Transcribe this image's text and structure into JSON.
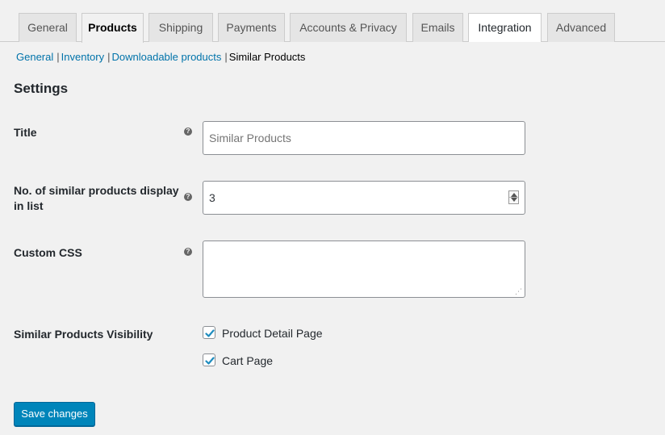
{
  "tabs": [
    {
      "label": "General"
    },
    {
      "label": "Products"
    },
    {
      "label": "Shipping"
    },
    {
      "label": "Payments"
    },
    {
      "label": "Accounts & Privacy"
    },
    {
      "label": "Emails"
    },
    {
      "label": "Integration"
    },
    {
      "label": "Advanced"
    }
  ],
  "subnav": {
    "items": [
      "General",
      "Inventory",
      "Downloadable products"
    ],
    "current": "Similar Products",
    "separator": "|"
  },
  "section_title": "Settings",
  "fields": {
    "title": {
      "label": "Title",
      "placeholder": "Similar Products",
      "value": ""
    },
    "count": {
      "label_line1": "No. of similar products display",
      "label_line2": "in list",
      "value": "3"
    },
    "css": {
      "label": "Custom CSS",
      "value": ""
    },
    "visibility": {
      "label": "Similar Products Visibility",
      "options": [
        {
          "label": "Product Detail Page",
          "checked": true
        },
        {
          "label": "Cart Page",
          "checked": true
        }
      ]
    }
  },
  "help_icon": "?",
  "save_label": "Save changes",
  "colors": {
    "accent": "#0085ba",
    "link": "#0073aa"
  }
}
